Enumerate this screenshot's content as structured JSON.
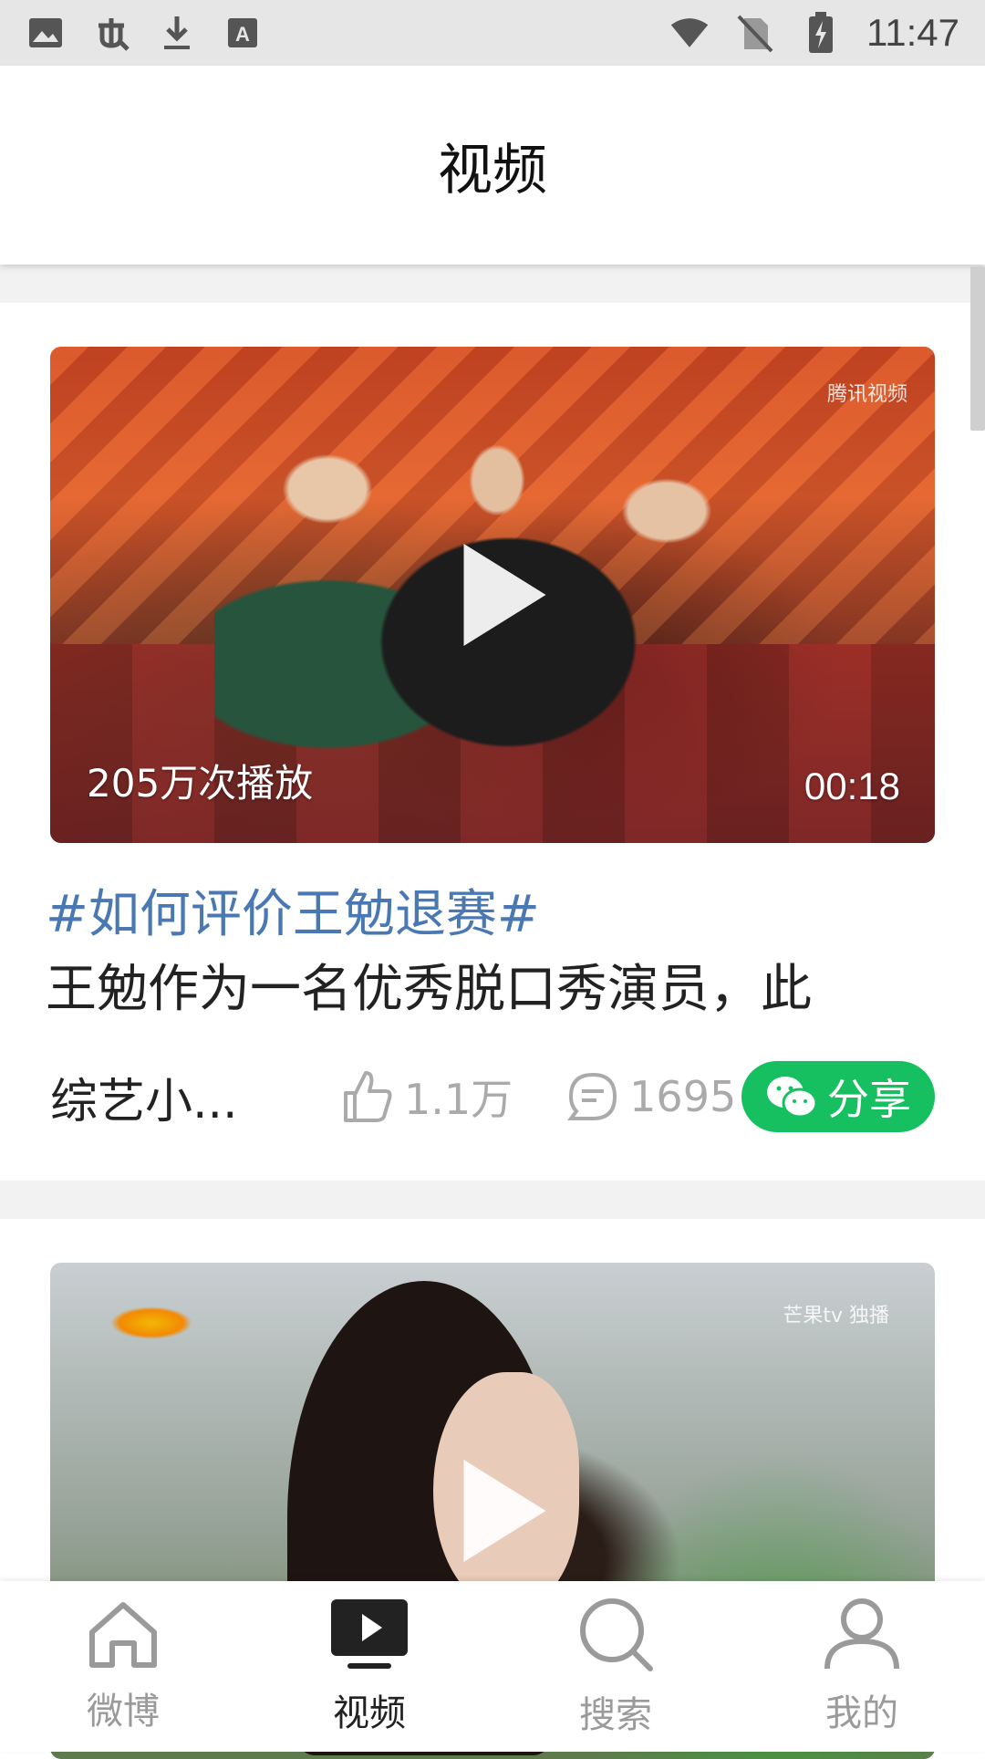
{
  "status_bar": {
    "time": "11:47",
    "left_icons": [
      "image-icon",
      "bug-icon",
      "download-icon",
      "text-icon"
    ],
    "right_icons": [
      "wifi-icon",
      "no-sim-icon",
      "battery-charging-icon"
    ]
  },
  "header": {
    "title": "视频"
  },
  "feed": [
    {
      "plays": "205万次播放",
      "duration": "00:18",
      "watermark": "腾讯视频",
      "topic": "#如何评价王勉退赛#",
      "description": "王勉作为一名优秀脱口秀演员，此",
      "author": "综艺小...",
      "likes": "1.1万",
      "comments": "1695",
      "share_label": "分享"
    },
    {
      "watermark": "芒果tv 独播"
    }
  ],
  "bottom_nav": [
    {
      "label": "微博",
      "icon": "home-icon"
    },
    {
      "label": "视频",
      "icon": "video-icon",
      "active": true
    },
    {
      "label": "搜索",
      "icon": "search-icon"
    },
    {
      "label": "我的",
      "icon": "user-icon"
    }
  ],
  "colors": {
    "topic": "#4a78b3",
    "share_button": "#16c060",
    "status_bar": "#e6e6e6"
  }
}
